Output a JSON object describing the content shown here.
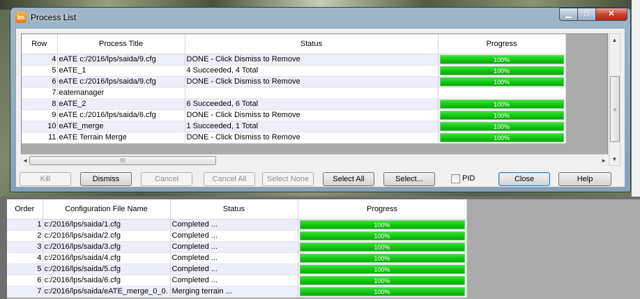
{
  "window": {
    "title": "Process List",
    "icon_text": "Im",
    "controls": {
      "minimize": "▁",
      "maximize": "□",
      "close": "✕"
    }
  },
  "process_table": {
    "columns": [
      "Row",
      "Process Title",
      "Status",
      "Progress"
    ],
    "rows": [
      {
        "row": "4",
        "title": "eATE c:/2016/lps/saida/9.cfg",
        "status": "DONE - Click Dismiss to Remove",
        "progress": "100%"
      },
      {
        "row": "5",
        "title": "eATE_1",
        "status": "4 Succeeded, 4 Total",
        "progress": "100%"
      },
      {
        "row": "6",
        "title": "eATE c:/2016/lps/saida/9.cfg",
        "status": "DONE - Click Dismiss to Remove",
        "progress": "100%"
      },
      {
        "row": "7",
        "title": "eatemanager",
        "status": "",
        "progress": ""
      },
      {
        "row": "8",
        "title": "eATE_2",
        "status": "6 Succeeded, 6 Total",
        "progress": "100%"
      },
      {
        "row": "9",
        "title": "eATE c:/2016/lps/saida/6.cfg",
        "status": "DONE - Click Dismiss to Remove",
        "progress": "100%"
      },
      {
        "row": "10",
        "title": "eATE_merge",
        "status": "1 Succeeded, 1 Total",
        "progress": "100%"
      },
      {
        "row": "11",
        "title": "eATE Terrain Merge",
        "status": "DONE - Click Dismiss to Remove",
        "progress": "100%"
      }
    ]
  },
  "scrollbars": {
    "up": "▲",
    "down": "▼",
    "left": "◄",
    "right": "►",
    "grip_v": "≡",
    "grip_h": "III"
  },
  "buttons": {
    "kill": "Kill",
    "dismiss": "Dismiss",
    "cancel": "Cancel",
    "cancel_all": "Cancel All",
    "select_none": "Select None",
    "select_all": "Select All",
    "select": "Select...",
    "pid": "PID",
    "close": "Close",
    "help": "Help"
  },
  "config_table": {
    "columns": [
      "Order",
      "Configuration File Name",
      "Status",
      "Progress"
    ],
    "rows": [
      {
        "order": "1",
        "file": "c:/2016/lps/saida/1.cfg",
        "status": "Completed ...",
        "progress": "100%"
      },
      {
        "order": "2",
        "file": "c:/2016/lps/saida/2.cfg",
        "status": "Completed ...",
        "progress": "100%"
      },
      {
        "order": "3",
        "file": "c:/2016/lps/saida/3.cfg",
        "status": "Completed ...",
        "progress": "100%"
      },
      {
        "order": "4",
        "file": "c:/2016/lps/saida/4.cfg",
        "status": "Completed ...",
        "progress": "100%"
      },
      {
        "order": "5",
        "file": "c:/2016/lps/saida/5.cfg",
        "status": "Completed ...",
        "progress": "100%"
      },
      {
        "order": "6",
        "file": "c:/2016/lps/saida/6.cfg",
        "status": "Completed ...",
        "progress": "100%"
      },
      {
        "order": "7",
        "file": "c:/2016/lps/saida/eATE_merge_0_0.",
        "status": "Merging terrain ...",
        "progress": "100%"
      }
    ]
  },
  "colors": {
    "progress_green": "#12c512",
    "row_alt": "#eeeefa",
    "grid_bg": "#ababab"
  }
}
